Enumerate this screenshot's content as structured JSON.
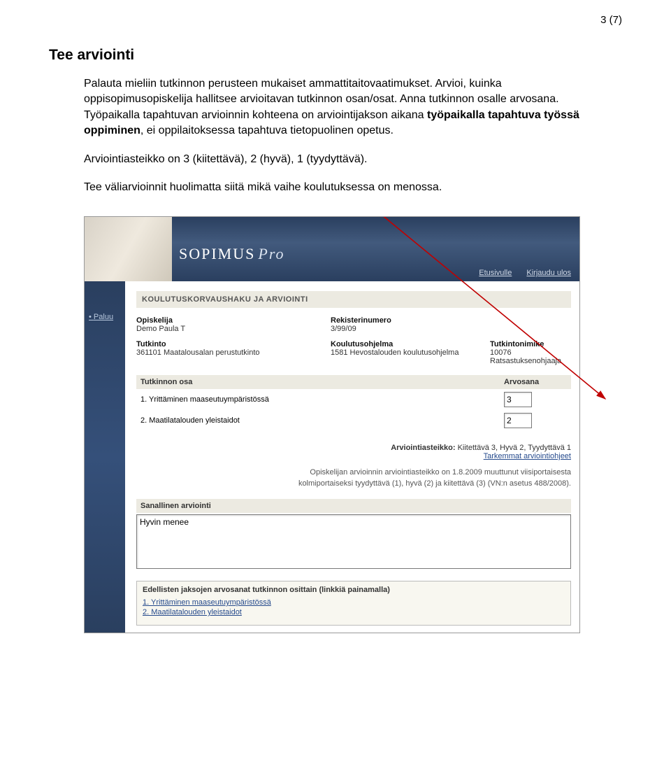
{
  "page_number_label": "3 (7)",
  "section_title": "Tee arviointi",
  "para1": "Palauta mieliin tutkinnon perusteen mukaiset ammattitaitovaatimukset. Arvioi, kuinka oppisopimusopiskelija hallitsee arvioitavan tutkinnon osan/osat. Anna tutkinnon osalle arvosana. Työpaikalla tapahtuvan arvioinnin kohteena on arviointijakson aikana ",
  "para1_bold": "työpaikalla tapahtuva työssä oppiminen",
  "para1_tail": ", ei oppilaitoksessa tapahtuva tietopuolinen opetus.",
  "para2": "Arviointiasteikko on 3 (kiitettävä), 2 (hyvä), 1 (tyydyttävä).",
  "para3": "Tee väliarvioinnit huolimatta siitä mikä vaihe koulutuksessa on menossa.",
  "app": {
    "logo_main": "SOPIMUS",
    "logo_sub": "Pro",
    "banner_links": {
      "home": "Etusivulle",
      "logout": "Kirjaudu ulos"
    },
    "sidebar_back": "Paluu",
    "header_bar": "KOULUTUSKORVAUSHAKU JA ARVIOINTI",
    "meta": {
      "opiskelija_label": "Opiskelija",
      "opiskelija_val": "Demo  Paula T",
      "rekisteri_label": "Rekisterinumero",
      "rekisteri_val": "3/99/09",
      "tutkinto_label": "Tutkinto",
      "tutkinto_val": "361101 Maatalousalan perustutkinto",
      "ohjelma_label": "Koulutusohjelma",
      "ohjelma_val": "1581 Hevostalouden koulutusohjelma",
      "nimike_label": "Tutkintonimike",
      "nimike_val": "10076 Ratsastuksenohjaaja"
    },
    "table": {
      "col_osa": "Tutkinnon osa",
      "col_arvosana": "Arvosana",
      "rows": [
        {
          "label": "1. Yrittäminen maaseutuympäristössä",
          "grade": "3"
        },
        {
          "label": "2. Maatilatalouden yleistaidot",
          "grade": "2"
        }
      ]
    },
    "scale_label": "Arviointiasteikko:",
    "scale_text": "Kiitettävä 3, Hyvä 2, Tyydyttävä 1",
    "scale_link": "Tarkemmat arviointiohjeet",
    "note": "Opiskelijan arvioinnin arviointiasteikko on 1.8.2009 muuttunut viisiportaisesta kolmiportaiseksi tyydyttävä (1), hyvä (2) ja kiitettävä (3) (VN:n asetus 488/2008).",
    "sanallinen_title": "Sanallinen arviointi",
    "sanallinen_value": "Hyvin menee",
    "prev_title": "Edellisten jaksojen arvosanat tutkinnon osittain (linkkiä painamalla)",
    "prev_links": [
      "1. Yrittäminen maaseutuympäristössä",
      "2. Maatilatalouden yleistaidot"
    ]
  }
}
